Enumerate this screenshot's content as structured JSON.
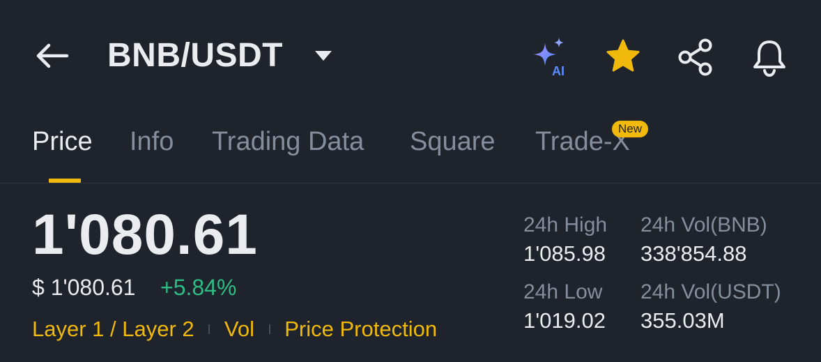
{
  "header": {
    "pair": "BNB/USDT",
    "ai_label": "AI",
    "icons": [
      "back-arrow-icon",
      "chevron-down-icon",
      "ai-sparkle-icon",
      "star-icon",
      "share-icon",
      "bell-icon"
    ]
  },
  "tabs": [
    {
      "label": "Price",
      "active": true
    },
    {
      "label": "Info"
    },
    {
      "label": "Trading Data"
    },
    {
      "label": "Square"
    },
    {
      "label": "Trade-X",
      "badge": "New"
    }
  ],
  "price": {
    "last": "1'080.61",
    "usd": "$ 1'080.61",
    "change": "+5.84%"
  },
  "tags": [
    "Layer 1 / Layer 2",
    "Vol",
    "Price Protection"
  ],
  "stats": {
    "high_label": "24h High",
    "high_value": "1'085.98",
    "low_label": "24h Low",
    "low_value": "1'019.02",
    "vol_base_label": "24h Vol(BNB)",
    "vol_base_value": "338'854.88",
    "vol_quote_label": "24h Vol(USDT)",
    "vol_quote_value": "355.03M"
  },
  "colors": {
    "background": "#1f232b",
    "accent": "#f0b90b",
    "positive": "#2ebd85",
    "muted": "#848e9c",
    "text": "#eaecef"
  }
}
